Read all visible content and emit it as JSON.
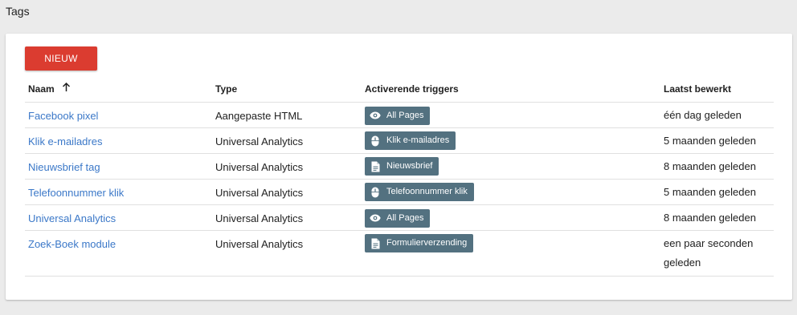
{
  "page": {
    "title": "Tags"
  },
  "toolbar": {
    "new_label": "NIEUW"
  },
  "table": {
    "headers": {
      "name": "Naam",
      "type": "Type",
      "triggers": "Activerende triggers",
      "last_edited": "Laatst bewerkt"
    },
    "sort": {
      "column": "name",
      "direction_icon": "arrow-up-icon"
    },
    "rows": [
      {
        "name": "Facebook pixel",
        "type": "Aangepaste HTML",
        "trigger_label": "All Pages",
        "trigger_icon": "eye-icon",
        "last_edited": "één dag geleden"
      },
      {
        "name": "Klik e-mailadres",
        "type": "Universal Analytics",
        "trigger_label": "Klik e-mailadres",
        "trigger_icon": "mouse-icon",
        "last_edited": "5 maanden geleden"
      },
      {
        "name": "Nieuwsbrief tag",
        "type": "Universal Analytics",
        "trigger_label": "Nieuwsbrief",
        "trigger_icon": "document-icon",
        "last_edited": "8 maanden geleden"
      },
      {
        "name": "Telefoonnummer klik",
        "type": "Universal Analytics",
        "trigger_label": "Telefoonnummer klik",
        "trigger_icon": "mouse-icon",
        "last_edited": "5 maanden geleden"
      },
      {
        "name": "Universal Analytics",
        "type": "Universal Analytics",
        "trigger_label": "All Pages",
        "trigger_icon": "eye-icon",
        "last_edited": "8 maanden geleden"
      },
      {
        "name": "Zoek-Boek module",
        "type": "Universal Analytics",
        "trigger_label": "Formulierverzending",
        "trigger_icon": "document-icon",
        "last_edited": "een paar seconden geleden"
      }
    ]
  },
  "colors": {
    "accent_red": "#db3c30",
    "link_blue": "#3b78c8",
    "chip_bg": "#537180"
  }
}
